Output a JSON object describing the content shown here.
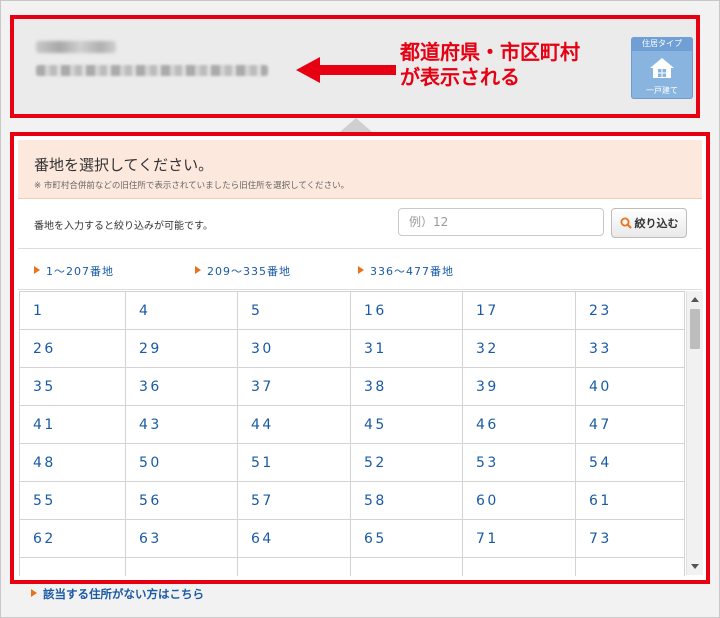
{
  "annotation": {
    "line1": "都道府県・市区町村",
    "line2": "が表示される"
  },
  "type_badge": {
    "title": "住居タイプ",
    "label": "一戸建て",
    "icon": "house-icon"
  },
  "panel": {
    "title": "番地を選択してください。",
    "note": "※ 市町村合併前などの旧住所で表示されていましたら旧住所を選択してください。"
  },
  "filter": {
    "hint": "番地を入力すると絞り込みが可能です。",
    "placeholder": "例）12",
    "value": "",
    "button_label": "絞り込む",
    "button_icon": "search-icon"
  },
  "ranges": [
    {
      "label": "1～207番地"
    },
    {
      "label": "209～335番地"
    },
    {
      "label": "336～477番地"
    }
  ],
  "numbers": [
    "1",
    "4",
    "5",
    "16",
    "17",
    "23",
    "26",
    "29",
    "30",
    "31",
    "32",
    "33",
    "35",
    "36",
    "37",
    "38",
    "39",
    "40",
    "41",
    "43",
    "44",
    "45",
    "46",
    "47",
    "48",
    "50",
    "51",
    "52",
    "53",
    "54",
    "55",
    "56",
    "57",
    "58",
    "60",
    "61",
    "62",
    "63",
    "64",
    "65",
    "71",
    "73",
    "",
    "",
    "",
    "",
    "",
    ""
  ],
  "footer": {
    "link": "該当する住所がない方はこちら"
  },
  "colors": {
    "highlight_red": "#e60012",
    "link_blue": "#1a5aa6",
    "header_pink": "#fde8de",
    "badge_blue": "#8ab4e0"
  }
}
